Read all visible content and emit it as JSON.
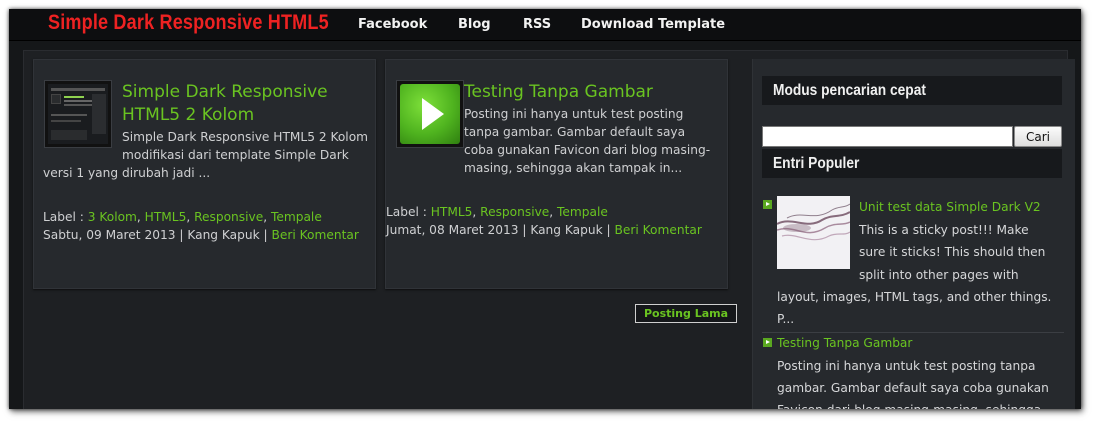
{
  "header": {
    "site_title": "Simple Dark Responsive HTML5",
    "nav": [
      "Facebook",
      "Blog",
      "RSS",
      "Download Template"
    ]
  },
  "posts": [
    {
      "title_line1": "Simple Dark Responsive",
      "title_line2": "HTML5 2 Kolom",
      "excerpt_line1": "Simple Dark Responsive HTML5 2 Kolom",
      "excerpt_line2": "modifikasi dari template Simple Dark",
      "excerpt_line3": "versi 1 yang dirubah jadi ...",
      "label_prefix": "Label : ",
      "labels": [
        "3 Kolom",
        "HTML5",
        "Responsive",
        "Tempale"
      ],
      "date_author": "Sabtu, 09 Maret 2013 | Kang Kapuk | ",
      "comment_link": "Beri Komentar"
    },
    {
      "title": "Testing Tanpa Gambar",
      "excerpt_line1": "Posting ini hanya untuk test posting",
      "excerpt_line2": "tanpa gambar. Gambar default saya",
      "excerpt_line3": "coba gunakan Favicon dari blog masing-",
      "excerpt_line4": "masing, sehingga akan tampak in...",
      "label_prefix": "Label : ",
      "labels": [
        "HTML5",
        "Responsive",
        "Tempale"
      ],
      "date_author": "Jumat, 08 Maret 2013 | Kang Kapuk | ",
      "comment_link": "Beri Komentar"
    }
  ],
  "pagination": {
    "older_label": "Posting Lama"
  },
  "sidebar": {
    "search_heading": "Modus pencarian cepat",
    "search_value": "",
    "search_button": "Cari",
    "popular_heading": "Entri Populer",
    "popular": [
      {
        "title": "Unit test data Simple Dark V2",
        "text_line1": "This is a sticky post!!! Make",
        "text_line2": "sure it sticks! This should then",
        "text_line3": "split into other pages with",
        "text_line4": "layout, images, HTML tags, and other things.",
        "text_line5": "P..."
      },
      {
        "title": "Testing Tanpa Gambar",
        "text_line1": "Posting ini hanya untuk test posting tanpa",
        "text_line2": "gambar. Gambar default saya coba gunakan",
        "text_line3": "Favicon dari blog masing-masing, sehingga"
      }
    ]
  },
  "colors": {
    "accent_green": "#6ac421",
    "title_red": "#ee2222",
    "background": "#151719"
  }
}
